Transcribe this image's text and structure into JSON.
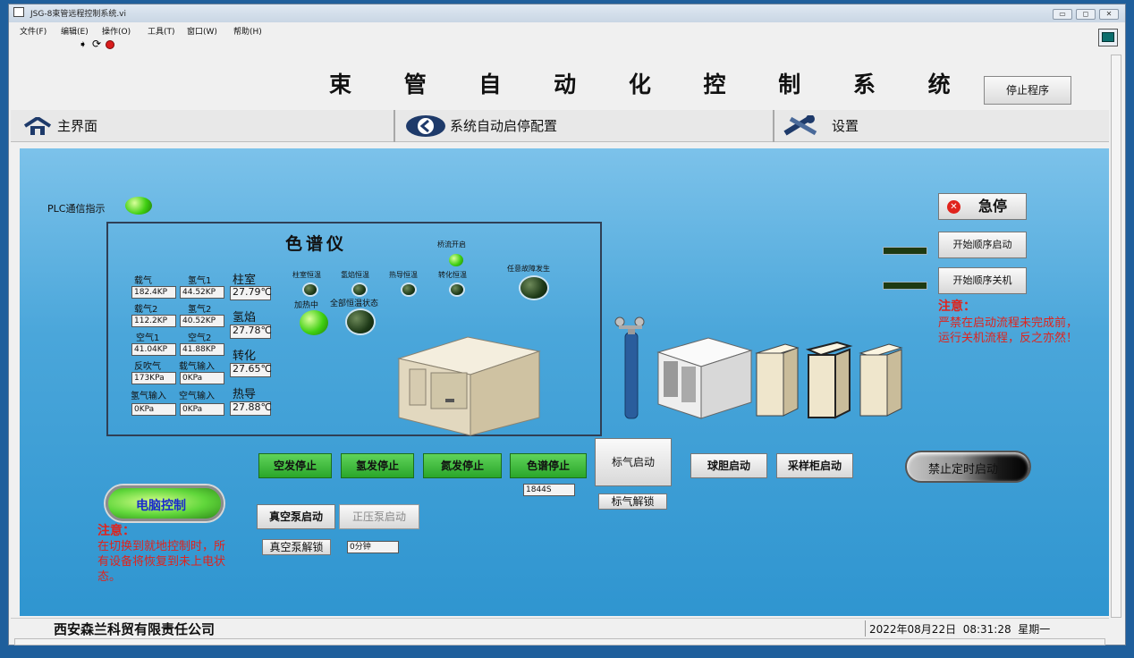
{
  "window": {
    "title": "JSG-8束管远程控制系统.vi"
  },
  "menu": [
    "文件(F)",
    "编辑(E)",
    "操作(O)",
    "工具(T)",
    "窗口(W)",
    "帮助(H)"
  ],
  "header": {
    "title": "束 管 自 动 化 控 制 系 统",
    "stop_program": "停止程序"
  },
  "tabs": [
    {
      "label": "主界面",
      "icon": "home-icon"
    },
    {
      "label": "系统自动启停配置",
      "icon": "back-arrow-icon"
    },
    {
      "label": "设置",
      "icon": "tools-icon"
    }
  ],
  "plc": {
    "label": "PLC通信指示"
  },
  "chromatograph": {
    "title": "色谱仪",
    "labels": {
      "carrier1": "载气",
      "h1": "氢气1",
      "column": "柱室",
      "carrier2": "载气2",
      "h2": "氢气2",
      "hflame": "氢焰",
      "air1": "空气1",
      "air2": "空气2",
      "convert": "转化",
      "backblow": "反吹气",
      "carrier_in": "载气输入",
      "thermal": "热导",
      "h_in": "氢气输入",
      "air_in": "空气输入"
    },
    "values": {
      "carrier1": "182.4KP",
      "h1": "44.52KP",
      "column": "27.79℃",
      "carrier2": "112.2KP",
      "h2": "40.52KP",
      "hflame": "27.78℃",
      "air1": "41.04KP",
      "air2": "41.88KP",
      "convert": "27.65℃",
      "backblow": "173KPa",
      "carrier_in": "0KPa",
      "thermal": "27.88℃",
      "h_in": "0KPa",
      "air_in": "0KPa"
    },
    "indicators": {
      "col_const": "柱室恒温",
      "hflame_const": "氢焰恒温",
      "thermal_const": "热导恒温",
      "convert_const": "转化恒温",
      "bridge": "桥流开启",
      "fault": "任意故障发生",
      "heating": "加热中",
      "all_const": "全部恒温状态"
    }
  },
  "controls": {
    "estop": "急停",
    "seq_start": "开始顺序启动",
    "seq_stop": "开始顺序关机",
    "note_title": "注意：",
    "note_right": "严禁在启动流程未完成前，运行关机流程，反之亦然！",
    "air_stop": "空发停止",
    "h_stop": "氢发停止",
    "n_stop": "氮发停止",
    "gc_stop": "色谱停止",
    "gc_timer": "1844S",
    "std_start": "标气启动",
    "std_unlock": "标气解锁",
    "ball_start": "球胆启动",
    "cabinet_start": "采样柜启动",
    "timer_ban": "禁止定时启动",
    "pc_control": "电脑控制",
    "note_left": "在切换到就地控制时，所有设备将恢复到未上电状态。",
    "vac_start": "真空泵启动",
    "pos_start": "正压泵启动",
    "vac_unlock": "真空泵解锁",
    "vac_timer": "0分钟"
  },
  "status": {
    "company": "西安森兰科贸有限责任公司",
    "datetime": "2022年08月22日  08:31:28  星期一"
  },
  "colors": {
    "panel_blue": "#3a9ed6",
    "green_button": "#3cbf3a",
    "note_red": "#e0231c"
  }
}
